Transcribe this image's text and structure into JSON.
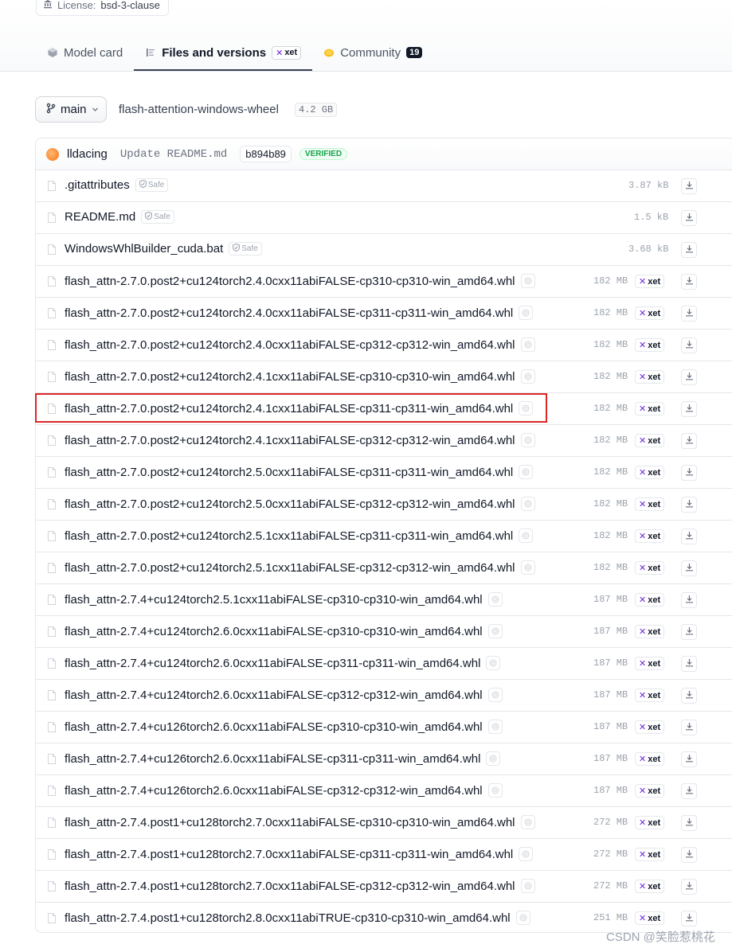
{
  "license": {
    "label": "License:",
    "value": "bsd-3-clause"
  },
  "tabs": [
    {
      "label": "Model card"
    },
    {
      "label": "Files and versions",
      "badge": "xet"
    },
    {
      "label": "Community",
      "count": "19"
    }
  ],
  "branch": {
    "label": "main"
  },
  "repo": {
    "name": "flash-attention-windows-wheel",
    "size": "4.2 GB"
  },
  "commit": {
    "author": "lldacing",
    "message": "Update README.md",
    "hash": "b894b89",
    "status": "VERIFIED"
  },
  "files": [
    {
      "name": ".gitattributes",
      "tag": "Safe",
      "size": "3.87 kB",
      "xet": ""
    },
    {
      "name": "README.md",
      "tag": "Safe",
      "size": "1.5 kB",
      "xet": ""
    },
    {
      "name": "WindowsWhlBuilder_cuda.bat",
      "tag": "Safe",
      "size": "3.68 kB",
      "xet": ""
    },
    {
      "name": "flash_attn-2.7.0.post2+cu124torch2.4.0cxx11abiFALSE-cp310-cp310-win_amd64.whl",
      "tag": "",
      "size": "182 MB",
      "xet": "xet"
    },
    {
      "name": "flash_attn-2.7.0.post2+cu124torch2.4.0cxx11abiFALSE-cp311-cp311-win_amd64.whl",
      "tag": "",
      "size": "182 MB",
      "xet": "xet"
    },
    {
      "name": "flash_attn-2.7.0.post2+cu124torch2.4.0cxx11abiFALSE-cp312-cp312-win_amd64.whl",
      "tag": "",
      "size": "182 MB",
      "xet": "xet"
    },
    {
      "name": "flash_attn-2.7.0.post2+cu124torch2.4.1cxx11abiFALSE-cp310-cp310-win_amd64.whl",
      "tag": "",
      "size": "182 MB",
      "xet": "xet"
    },
    {
      "name": "flash_attn-2.7.0.post2+cu124torch2.4.1cxx11abiFALSE-cp311-cp311-win_amd64.whl",
      "tag": "",
      "size": "182 MB",
      "xet": "xet"
    },
    {
      "name": "flash_attn-2.7.0.post2+cu124torch2.4.1cxx11abiFALSE-cp312-cp312-win_amd64.whl",
      "tag": "",
      "size": "182 MB",
      "xet": "xet"
    },
    {
      "name": "flash_attn-2.7.0.post2+cu124torch2.5.0cxx11abiFALSE-cp311-cp311-win_amd64.whl",
      "tag": "",
      "size": "182 MB",
      "xet": "xet"
    },
    {
      "name": "flash_attn-2.7.0.post2+cu124torch2.5.0cxx11abiFALSE-cp312-cp312-win_amd64.whl",
      "tag": "",
      "size": "182 MB",
      "xet": "xet"
    },
    {
      "name": "flash_attn-2.7.0.post2+cu124torch2.5.1cxx11abiFALSE-cp311-cp311-win_amd64.whl",
      "tag": "",
      "size": "182 MB",
      "xet": "xet"
    },
    {
      "name": "flash_attn-2.7.0.post2+cu124torch2.5.1cxx11abiFALSE-cp312-cp312-win_amd64.whl",
      "tag": "",
      "size": "182 MB",
      "xet": "xet"
    },
    {
      "name": "flash_attn-2.7.4+cu124torch2.5.1cxx11abiFALSE-cp310-cp310-win_amd64.whl",
      "tag": "",
      "size": "187 MB",
      "xet": "xet"
    },
    {
      "name": "flash_attn-2.7.4+cu124torch2.6.0cxx11abiFALSE-cp310-cp310-win_amd64.whl",
      "tag": "",
      "size": "187 MB",
      "xet": "xet"
    },
    {
      "name": "flash_attn-2.7.4+cu124torch2.6.0cxx11abiFALSE-cp311-cp311-win_amd64.whl",
      "tag": "",
      "size": "187 MB",
      "xet": "xet"
    },
    {
      "name": "flash_attn-2.7.4+cu124torch2.6.0cxx11abiFALSE-cp312-cp312-win_amd64.whl",
      "tag": "",
      "size": "187 MB",
      "xet": "xet"
    },
    {
      "name": "flash_attn-2.7.4+cu126torch2.6.0cxx11abiFALSE-cp310-cp310-win_amd64.whl",
      "tag": "",
      "size": "187 MB",
      "xet": "xet"
    },
    {
      "name": "flash_attn-2.7.4+cu126torch2.6.0cxx11abiFALSE-cp311-cp311-win_amd64.whl",
      "tag": "",
      "size": "187 MB",
      "xet": "xet"
    },
    {
      "name": "flash_attn-2.7.4+cu126torch2.6.0cxx11abiFALSE-cp312-cp312-win_amd64.whl",
      "tag": "",
      "size": "187 MB",
      "xet": "xet"
    },
    {
      "name": "flash_attn-2.7.4.post1+cu128torch2.7.0cxx11abiFALSE-cp310-cp310-win_amd64.whl",
      "tag": "",
      "size": "272 MB",
      "xet": "xet"
    },
    {
      "name": "flash_attn-2.7.4.post1+cu128torch2.7.0cxx11abiFALSE-cp311-cp311-win_amd64.whl",
      "tag": "",
      "size": "272 MB",
      "xet": "xet"
    },
    {
      "name": "flash_attn-2.7.4.post1+cu128torch2.7.0cxx11abiFALSE-cp312-cp312-win_amd64.whl",
      "tag": "",
      "size": "272 MB",
      "xet": "xet"
    },
    {
      "name": "flash_attn-2.7.4.post1+cu128torch2.8.0cxx11abiTRUE-cp310-cp310-win_amd64.whl",
      "tag": "",
      "size": "251 MB",
      "xet": "xet"
    }
  ],
  "highlighted_file_index": 7,
  "watermark": "CSDN @笑脸惹桃花",
  "colors": {
    "highlight": "#dc2626",
    "xet": "#6d28d9",
    "verified": "#16a34a",
    "avatar": "#f97316"
  }
}
